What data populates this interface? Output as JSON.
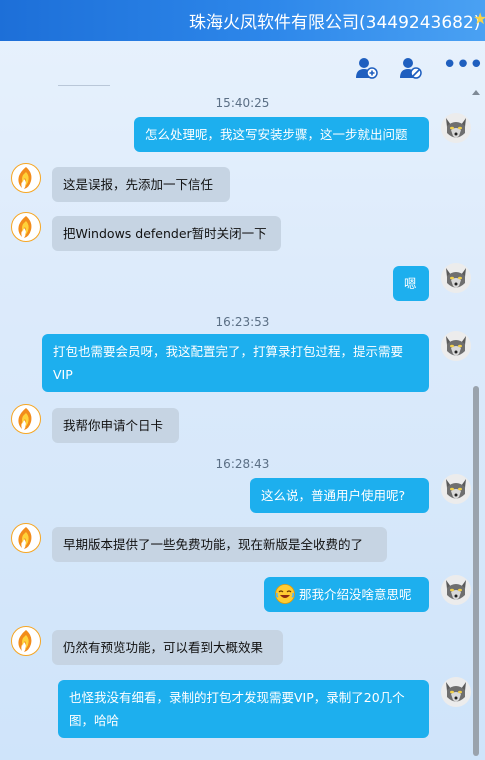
{
  "window": {
    "title": "珠海火凤软件有限公司(3449243682)"
  },
  "toolbar": {
    "add_member_icon": "user-plus-icon",
    "remove_member_icon": "user-block-icon",
    "more_icon": "more-icon",
    "more_glyph": "•••"
  },
  "colors": {
    "outgoing_bubble": "#1dafee",
    "incoming_bubble": "#c6d4e3",
    "title_bar": "#1d6fd8"
  },
  "timestamps": [
    "15:40:25",
    "16:23:53",
    "16:28:43"
  ],
  "messages": [
    {
      "side": "out",
      "text": "怎么处理呢，我这写安装步骤，这一步就出问题"
    },
    {
      "side": "in",
      "text": "这是误报，先添加一下信任"
    },
    {
      "side": "in",
      "text": "把Windows defender暂时关闭一下"
    },
    {
      "side": "out",
      "text": "嗯"
    },
    {
      "side": "out",
      "text": "打包也需要会员呀，我这配置完了，打算录打包过程，提示需要VIP"
    },
    {
      "side": "in",
      "text": "我帮你申请个日卡"
    },
    {
      "side": "out",
      "text": "这么说，普通用户使用呢?"
    },
    {
      "side": "in",
      "text": "早期版本提供了一些免费功能，现在新版是全收费的了"
    },
    {
      "side": "out",
      "text": "那我介绍没啥意思呢",
      "emoji": "laughing-crying-emoji"
    },
    {
      "side": "in",
      "text": "仍然有预览功能，可以看到大概效果"
    },
    {
      "side": "out",
      "text": "也怪我没有细看，录制的打包才发现需要VIP，录制了20几个图，哈哈"
    }
  ]
}
